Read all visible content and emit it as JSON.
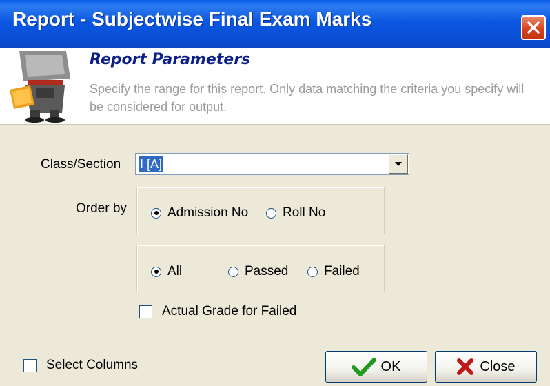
{
  "window": {
    "title": "Report - Subjectwise Final Exam Marks"
  },
  "banner": {
    "heading": "Report Parameters",
    "description": "Specify the range for this report. Only data matching the criteria you specify will be considered for output."
  },
  "form": {
    "class_section_label": "Class/Section",
    "class_section_value": "I [A]",
    "order_by_label": "Order by",
    "order_options": [
      {
        "label": "Admission No",
        "selected": true
      },
      {
        "label": "Roll No",
        "selected": false
      }
    ],
    "filter_options": [
      {
        "label": "All",
        "selected": true
      },
      {
        "label": "Passed",
        "selected": false
      },
      {
        "label": "Failed",
        "selected": false
      }
    ],
    "actual_grade_label": "Actual Grade for Failed",
    "actual_grade_checked": false
  },
  "footer": {
    "select_columns_label": "Select Columns",
    "select_columns_checked": false,
    "ok_label": "OK",
    "close_label": "Close"
  },
  "colors": {
    "titlebar": "#0A56E0",
    "banner_heading": "#0C1E88",
    "selection": "#316AC5"
  }
}
